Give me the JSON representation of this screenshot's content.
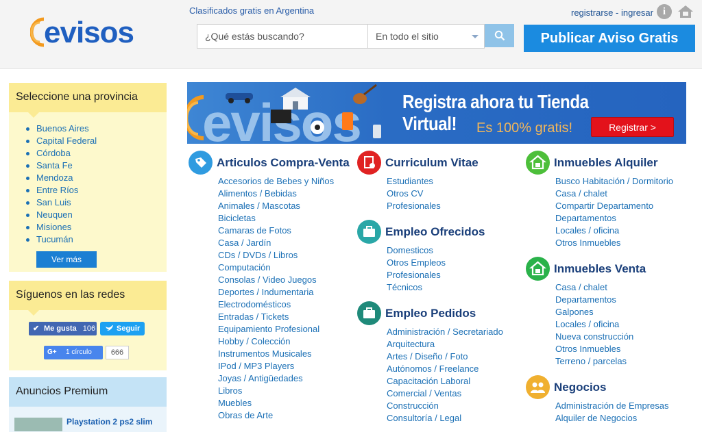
{
  "header": {
    "logo_text": "evisos",
    "tagline": "Clasificados gratis en Argentina",
    "search_placeholder": "¿Qué estás buscando?",
    "scope_selected": "En todo el sitio",
    "publish_label": "Publicar Aviso Gratis",
    "register_label": "registrarse",
    "separator": "-",
    "login_label": "ingresar",
    "info_glyph": "i"
  },
  "provinces": {
    "title": "Seleccione una provincia",
    "items": [
      "Buenos Aires",
      "Capital Federal",
      "Córdoba",
      "Santa Fe",
      "Mendoza",
      "Entre Ríos",
      "San Luis",
      "Neuquen",
      "Misiones",
      "Tucumán"
    ],
    "more_label": "Ver más"
  },
  "social": {
    "title": "Síguenos en las redes",
    "fb_label": "Me gusta",
    "fb_count": "106",
    "tw_label": "Seguir",
    "gplus_label": "1 círculo",
    "gplus_g": "G+",
    "gplus_count": "666"
  },
  "premium": {
    "title": "Anuncios Premium",
    "item_title": "Playstation 2 ps2 slim"
  },
  "banner": {
    "title": "Registra ahora tu Tienda Virtual!",
    "subtitle": "Es 100% gratis!",
    "button": "Registrar >",
    "logo_text": "evisos"
  },
  "categories": {
    "articulos": {
      "title": "Articulos Compra-Venta",
      "icon": "tag-icon",
      "links": [
        "Accesorios de Bebes y Niños",
        "Alimentos / Bebidas",
        "Animales / Mascotas",
        "Bicicletas",
        "Camaras de Fotos",
        "Casa / Jardín",
        "CDs / DVDs / Libros",
        "Computación",
        "Consolas / Video Juegos",
        "Deportes / Indumentaria",
        "Electrodomésticos",
        "Entradas / Tickets",
        "Equipamiento Profesional",
        "Hobby / Colección",
        "Instrumentos Musicales",
        "IPod / MP3 Players",
        "Joyas / Antigüedades",
        "Libros",
        "Muebles",
        "Obras de Arte"
      ]
    },
    "curriculum": {
      "title": "Curriculum Vitae",
      "icon": "cv-icon",
      "links": [
        "Estudiantes",
        "Otros CV",
        "Profesionales"
      ]
    },
    "empleo_ofrecidos": {
      "title": "Empleo Ofrecidos",
      "icon": "briefcase-icon",
      "links": [
        "Domesticos",
        "Otros Empleos",
        "Profesionales",
        "Técnicos"
      ]
    },
    "empleo_pedidos": {
      "title": "Empleo Pedidos",
      "icon": "briefcase-icon",
      "links": [
        "Administración / Secretariado",
        "Arquitectura",
        "Artes / Diseño / Foto",
        "Autónomos / Freelance",
        "Capacitación Laboral",
        "Comercial / Ventas",
        "Construcción",
        "Consultoría / Legal"
      ]
    },
    "inmuebles_alquiler": {
      "title": "Inmuebles Alquiler",
      "icon": "house-icon",
      "links": [
        "Busco Habitación / Dormitorio",
        "Casa / chalet",
        "Compartir Departamento",
        "Departamentos",
        "Locales / oficina",
        "Otros Inmuebles"
      ]
    },
    "inmuebles_venta": {
      "title": "Inmuebles Venta",
      "icon": "house-icon",
      "links": [
        "Casa / chalet",
        "Departamentos",
        "Galpones",
        "Locales / oficina",
        "Nueva construcción",
        "Otros Inmuebles",
        "Terreno / parcelas"
      ]
    },
    "negocios": {
      "title": "Negocios",
      "icon": "people-icon",
      "links": [
        "Administración de Empresas",
        "Alquiler de Negocios"
      ]
    }
  },
  "colors": {
    "brand_blue": "#1b8be0",
    "link": "#1a6fb5",
    "heading": "#1a3f7a",
    "tag_icon": "#2f9be0",
    "cv_icon": "#e02222",
    "briefcase_icon": "#2aa7a7",
    "house_icon": "#4dbf3a",
    "people_icon": "#f0b030"
  }
}
